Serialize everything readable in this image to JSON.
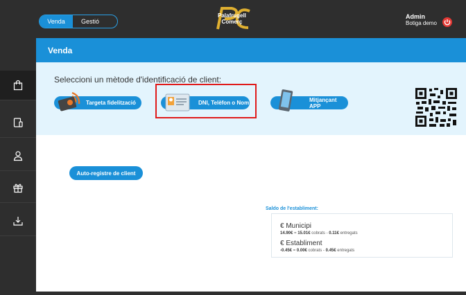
{
  "topbar": {
    "tabs": [
      {
        "label": "Venda"
      },
      {
        "label": "Gestió"
      }
    ],
    "logo_line1": "Palafrugell",
    "logo_line2": "Comerç",
    "user_name": "Admin",
    "user_store": "Botiga demo",
    "logout_icon": "power-icon"
  },
  "sidebar": {
    "items": [
      {
        "icon": "shopping-bag-icon",
        "active": true
      },
      {
        "icon": "device-icon"
      },
      {
        "icon": "user-icon"
      },
      {
        "icon": "gift-icon"
      },
      {
        "icon": "download-tray-icon"
      }
    ]
  },
  "header": {
    "title": "Venda"
  },
  "identify": {
    "prompt": "Seleccioni un mètode d'identificació de client:",
    "options": [
      {
        "label": "Targeta fidelització",
        "icon": "loyalty-card-icon"
      },
      {
        "label": "DNI, Telèfon o Nom",
        "icon": "id-card-icon",
        "highlighted": true
      },
      {
        "label": "Mitjançant APP",
        "icon": "smartphone-icon"
      }
    ],
    "qr_icon": "qr-code-icon"
  },
  "main": {
    "autoregister_label": "Auto-registre de client"
  },
  "saldo": {
    "title": "Saldo de l'establiment:",
    "municipi": {
      "title": "€ Municipi",
      "total": "14.90€",
      "cobrats": "15.01€",
      "cobrats_label": "cobrats",
      "entregats": "0.11€",
      "entregats_label": "entregats"
    },
    "establiment": {
      "title": "€ Establiment",
      "total": "-0.45€",
      "cobrats": "0.00€",
      "cobrats_label": "cobrats",
      "entregats": "0.45€",
      "entregats_label": "entregats"
    }
  },
  "colors": {
    "primary": "#1a90d8",
    "dark": "#2e2e2e",
    "panel": "#e3f4fd",
    "highlight": "#e01919"
  }
}
